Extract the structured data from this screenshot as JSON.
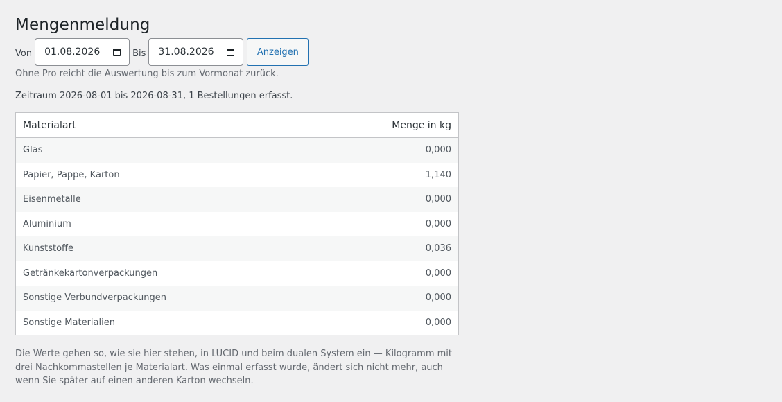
{
  "page": {
    "title": "Mengenmeldung"
  },
  "filter": {
    "from_label": "Von",
    "from_value": "01.08.2026",
    "to_label": "Bis",
    "to_value": "31.08.2026",
    "submit_label": "Anzeigen"
  },
  "notice": "Ohne Pro reicht die Auswertung bis zum Vormonat zurück.",
  "period_summary": "Zeitraum 2026-08-01 bis 2026-08-31, 1 Bestellungen erfasst.",
  "table": {
    "columns": [
      "Materialart",
      "Menge in kg"
    ],
    "rows": [
      {
        "material": "Glas",
        "amount": "0,000"
      },
      {
        "material": "Papier, Pappe, Karton",
        "amount": "1,140"
      },
      {
        "material": "Eisenmetalle",
        "amount": "0,000"
      },
      {
        "material": "Aluminium",
        "amount": "0,000"
      },
      {
        "material": "Kunststoffe",
        "amount": "0,036"
      },
      {
        "material": "Getränkekartonverpackungen",
        "amount": "0,000"
      },
      {
        "material": "Sonstige Verbundverpackungen",
        "amount": "0,000"
      },
      {
        "material": "Sonstige Materialien",
        "amount": "0,000"
      }
    ]
  },
  "footer": "Die Werte gehen so, wie sie hier stehen, in LUCID und beim dualen System ein — Kilogramm mit drei Nachkommastellen je Materialart. Was einmal erfasst wurde, ändert sich nicht mehr, auch wenn Sie später auf einen anderen Karton wechseln.",
  "icons": {
    "date_picker": "calendar-icon"
  },
  "colors": {
    "accent": "#2271b1",
    "background": "#f0f0f1"
  }
}
